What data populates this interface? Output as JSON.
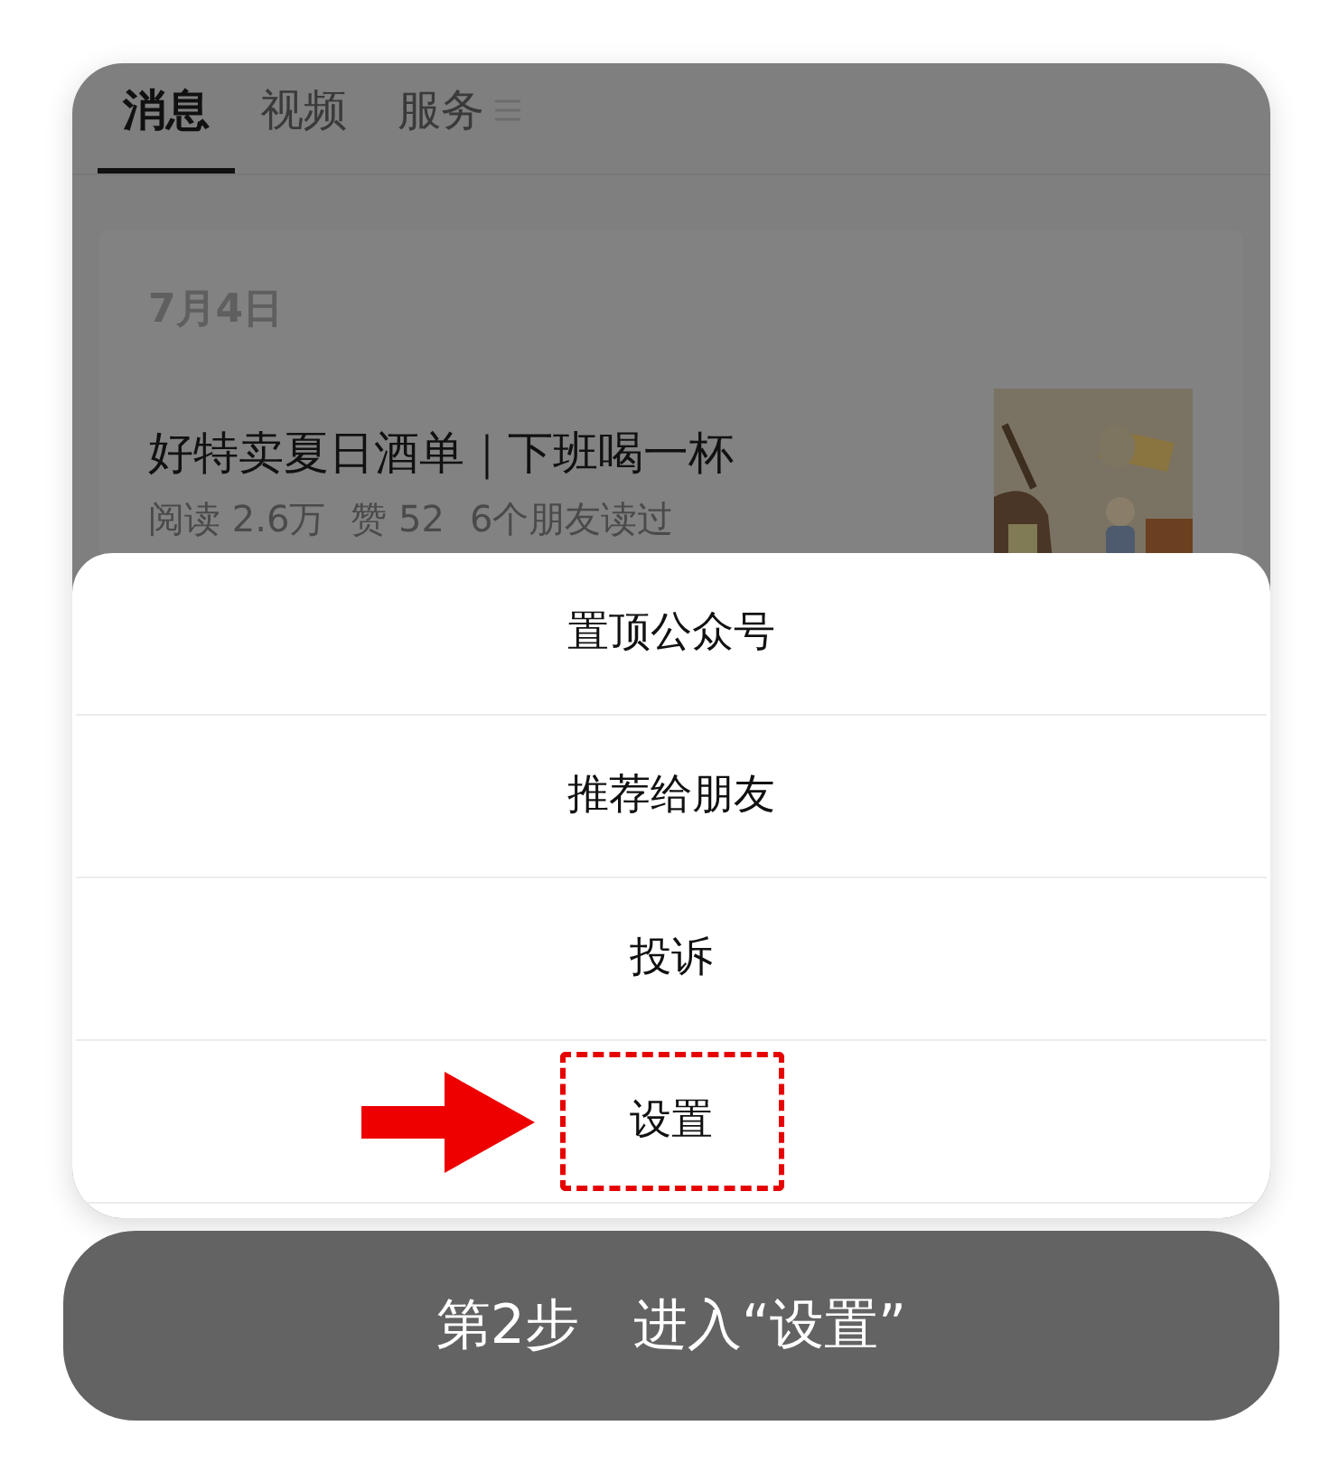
{
  "tabs": [
    {
      "label": "消息",
      "selected": true,
      "menu": false
    },
    {
      "label": "视频",
      "selected": false,
      "menu": false
    },
    {
      "label": "服务",
      "selected": false,
      "menu": true
    }
  ],
  "article": {
    "date": "7月4日",
    "title": "好特卖夏日酒单｜下班喝一杯",
    "stats": [
      "阅读 2.6万",
      "赞 52",
      "6个朋友读过"
    ],
    "thumbnail": {
      "kind": "picture"
    }
  },
  "menu": [
    {
      "label": "置顶公众号",
      "highlighted": false
    },
    {
      "label": "推荐给朋友",
      "highlighted": false
    },
    {
      "label": "投诉",
      "highlighted": false
    },
    {
      "label": "设置",
      "highlighted": true
    }
  ],
  "step_banner": "第2步　进入“设置”"
}
